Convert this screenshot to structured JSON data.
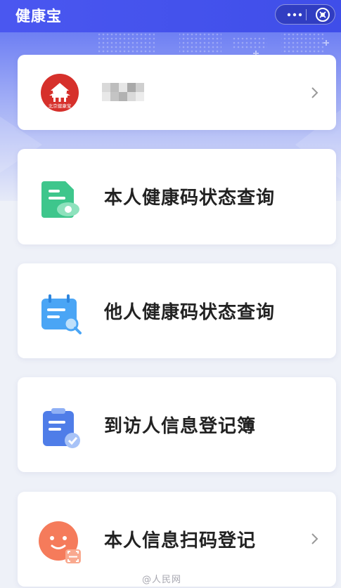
{
  "header": {
    "title": "健康宝",
    "more_icon": "more-dots-icon",
    "close_icon": "close-circle-icon",
    "bar_color": "#4350ec"
  },
  "profile": {
    "logo_text": "北京健康宝",
    "logo_icon": "beijing-health-logo",
    "logo_color": "#d6302b",
    "name_redacted": true
  },
  "menu": [
    {
      "label": "本人健康码状态查询",
      "icon": "document-eye-icon",
      "color": "#3ec68c"
    },
    {
      "label": "他人健康码状态查询",
      "icon": "calendar-search-icon",
      "color": "#4aa5f5"
    },
    {
      "label": "到访人信息登记簿",
      "icon": "clipboard-check-icon",
      "color": "#4f7de8"
    },
    {
      "label": "本人信息扫码登记",
      "icon": "face-scan-icon",
      "color": "#f57b5b"
    }
  ],
  "watermark": "@人民网"
}
